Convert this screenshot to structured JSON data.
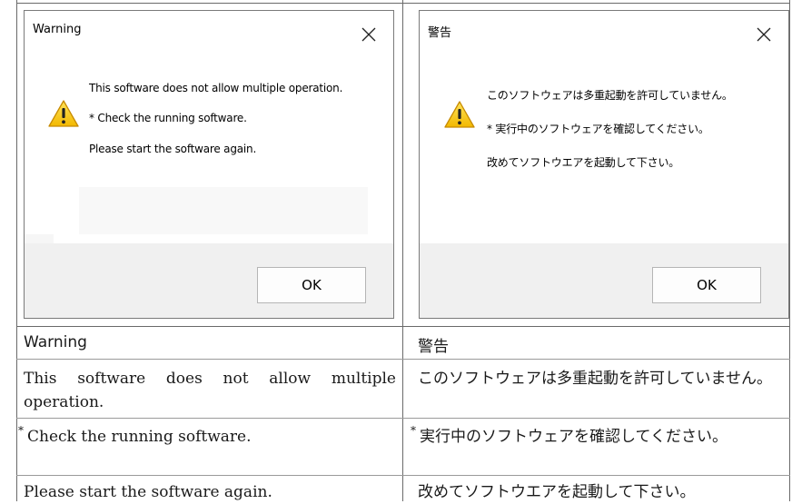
{
  "english": {
    "dialog": {
      "title": "Warning",
      "message_main": "This software does not allow multiple operation.",
      "message_check": "* Check the running software.",
      "message_restart": "Please start the software again.",
      "ok_label": "OK"
    },
    "caption_title": "Warning",
    "caption_main": "This software does not allow multiple operation.",
    "caption_check": "Check the running software.",
    "caption_restart": "Please start the software again."
  },
  "japanese": {
    "dialog": {
      "title": "警告",
      "message_main": "このソフトウェアは多重起動を許可していません。",
      "message_check": "* 実行中のソフトウェアを確認してください。",
      "message_restart": "改めてソフトウエアを起動して下さい。",
      "ok_label": "OK"
    },
    "caption_title": "警告",
    "caption_main": "このソフトウェアは多重起動を許可していません。",
    "caption_check": "実行中のソフトウェアを確認してください。",
    "caption_restart": "改めてソフトウエアを起動して下さい。"
  },
  "footnote_marker": "*",
  "icons": {
    "close": "close-icon",
    "warning": "warning-icon"
  },
  "colors": {
    "warning_fill": "#f5c518",
    "footer_bg": "#f0f0f0",
    "rule": "#6a6a6a"
  }
}
